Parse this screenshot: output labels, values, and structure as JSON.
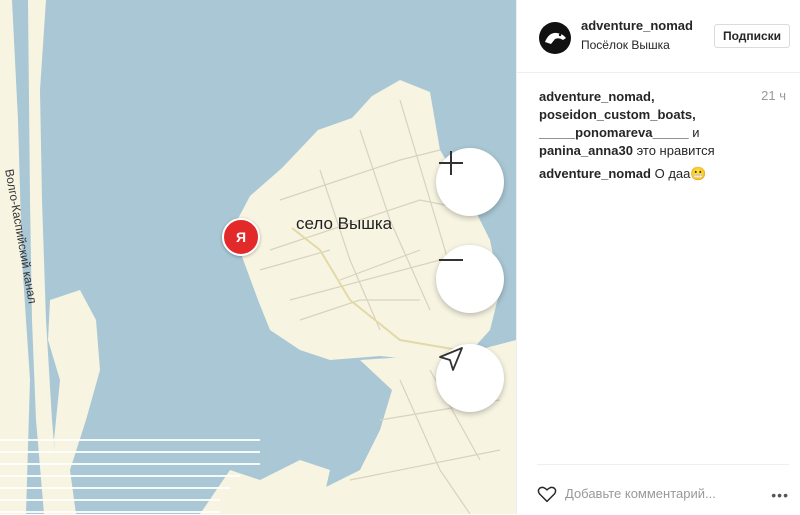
{
  "map": {
    "village_label": "село Вышка",
    "canal_label": "Волго-Каспийский канал",
    "pin_letter": "Я",
    "zoom_in_icon": "plus-icon",
    "zoom_out_icon": "minus-icon",
    "locate_icon": "navigation-arrow-icon",
    "colors": {
      "water": "#a9c7d4",
      "land": "#f7f4e2",
      "pin": "#e32a2a"
    }
  },
  "post": {
    "username": "adventure_nomad",
    "location": "Посёлок Вышка",
    "follow_label": "Подписки",
    "likes": {
      "users": [
        "adventure_nomad,",
        "poseidon_custom_boats,",
        "_____ponomareva_____"
      ],
      "and_word": "и",
      "last_user": "panina_anna30",
      "suffix": "это нравится"
    },
    "time": "21 ч",
    "comment": {
      "author": "adventure_nomad",
      "text": "О даа😬"
    },
    "comment_placeholder": "Добавьте комментарий...",
    "more_label": "•••"
  }
}
